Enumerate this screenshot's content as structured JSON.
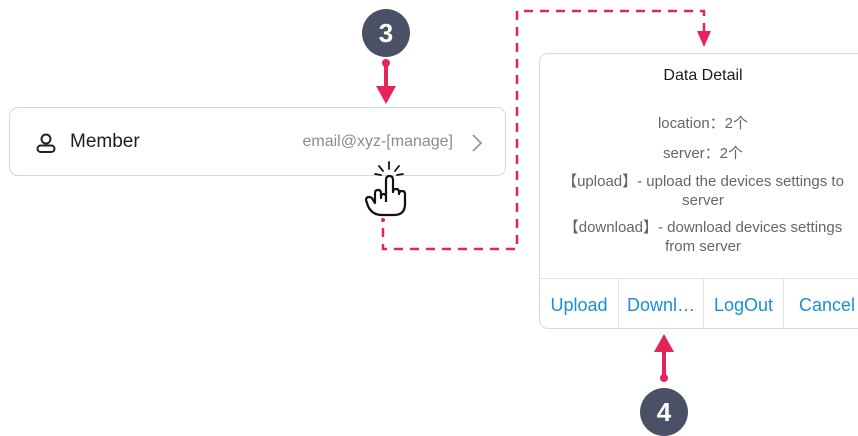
{
  "member_row": {
    "label": "Member",
    "value": "email@xyz-[manage]",
    "icon": "person-icon"
  },
  "steps": {
    "step3": "3",
    "step4": "4"
  },
  "dialog": {
    "title": "Data Detail",
    "location": "location：2个",
    "server": "server：2个",
    "upload_desc": "【upload】- upload the devices settings to server",
    "download_desc": "【download】- download devices settings from server",
    "actions": {
      "upload": "Upload",
      "download": "Downl…",
      "logout": "LogOut",
      "cancel": "Cancel"
    }
  },
  "colors": {
    "accent": "#1890d5",
    "annotation": "#e5245a",
    "badge": "#4a5167"
  }
}
